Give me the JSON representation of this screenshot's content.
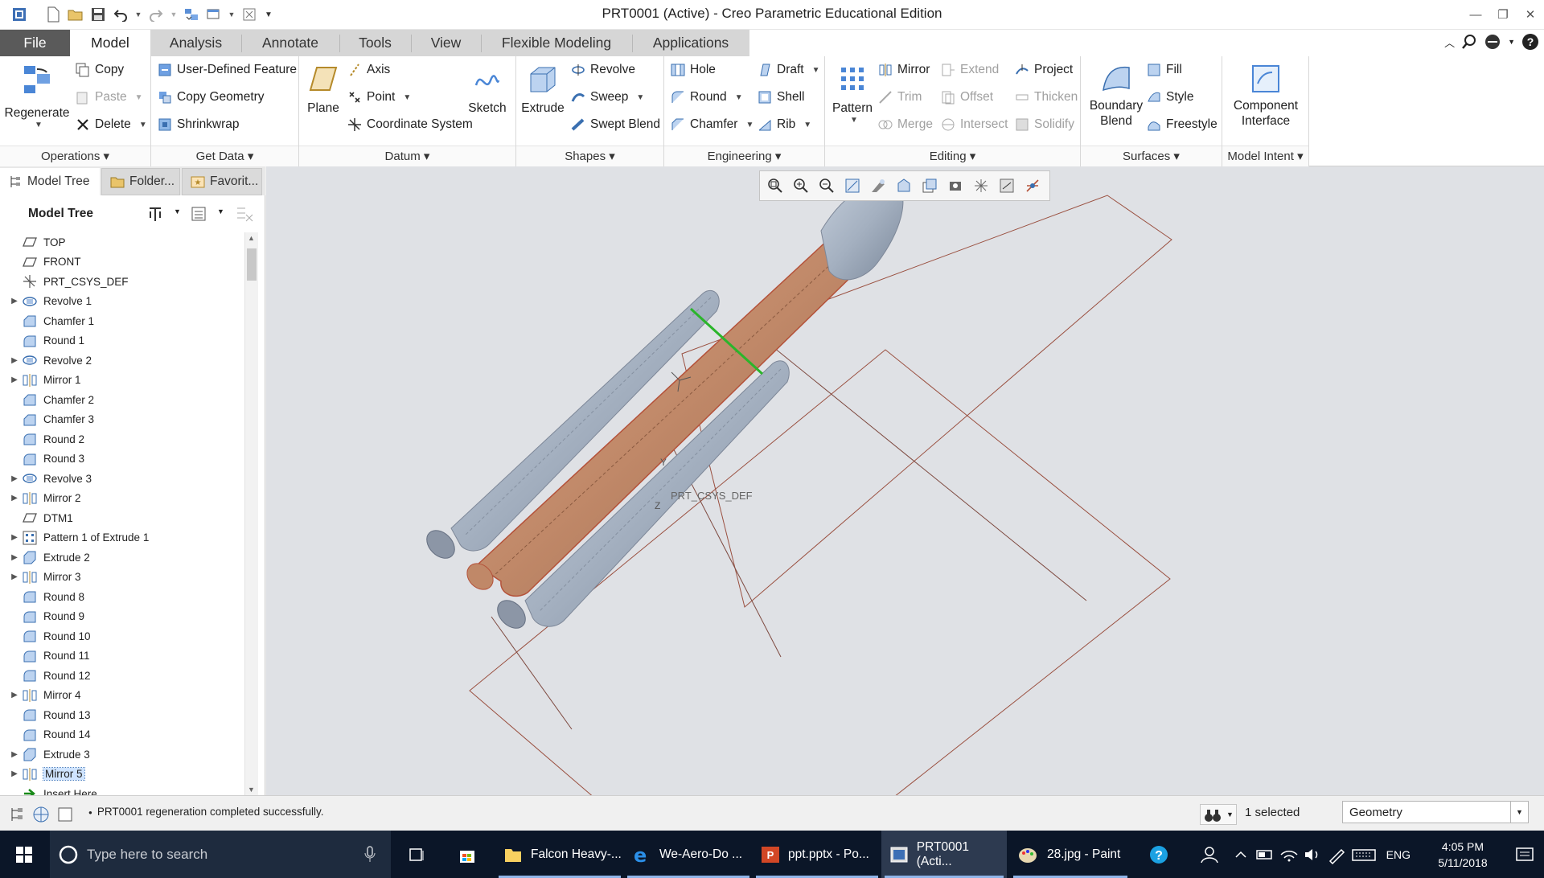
{
  "window": {
    "title": "PRT0001 (Active) - Creo Parametric Educational Edition"
  },
  "tabs": [
    "File",
    "Model",
    "Analysis",
    "Annotate",
    "Tools",
    "View",
    "Flexible Modeling",
    "Applications"
  ],
  "ribbon": {
    "operations": {
      "label": "Operations",
      "regenerate": "Regenerate",
      "copy": "Copy",
      "paste": "Paste",
      "delete": "Delete"
    },
    "get_data": {
      "label": "Get Data",
      "udf": "User-Defined Feature",
      "copy_geometry": "Copy Geometry",
      "shrinkwrap": "Shrinkwrap"
    },
    "datum": {
      "label": "Datum",
      "plane": "Plane",
      "axis": "Axis",
      "point": "Point",
      "csys": "Coordinate System",
      "sketch": "Sketch"
    },
    "shapes": {
      "label": "Shapes",
      "extrude": "Extrude",
      "revolve": "Revolve",
      "sweep": "Sweep",
      "swept_blend": "Swept Blend"
    },
    "engineering": {
      "label": "Engineering",
      "hole": "Hole",
      "round": "Round",
      "chamfer": "Chamfer",
      "draft": "Draft",
      "shell": "Shell",
      "rib": "Rib"
    },
    "editing": {
      "label": "Editing",
      "pattern": "Pattern",
      "mirror": "Mirror",
      "trim": "Trim",
      "merge": "Merge",
      "extend": "Extend",
      "offset": "Offset",
      "intersect": "Intersect",
      "project": "Project",
      "thicken": "Thicken",
      "solidify": "Solidify"
    },
    "surfaces": {
      "label": "Surfaces",
      "boundary_blend": "Boundary Blend",
      "fill": "Fill",
      "style": "Style",
      "freestyle": "Freestyle"
    },
    "model_intent": {
      "label": "Model Intent",
      "component_interface": "Component Interface"
    }
  },
  "navigator": {
    "tabs": [
      "Model Tree",
      "Folder...",
      "Favorit..."
    ],
    "header": "Model Tree"
  },
  "tree": [
    {
      "label": "TOP",
      "icon": "plane-icon",
      "expandable": false
    },
    {
      "label": "FRONT",
      "icon": "plane-icon",
      "expandable": false
    },
    {
      "label": "PRT_CSYS_DEF",
      "icon": "csys-icon",
      "expandable": false
    },
    {
      "label": "Revolve 1",
      "icon": "revolve-icon",
      "expandable": true
    },
    {
      "label": "Chamfer 1",
      "icon": "chamfer-icon",
      "expandable": false
    },
    {
      "label": "Round 1",
      "icon": "round-icon",
      "expandable": false
    },
    {
      "label": "Revolve 2",
      "icon": "revolve-icon",
      "expandable": true
    },
    {
      "label": "Mirror 1",
      "icon": "mirror-icon",
      "expandable": true
    },
    {
      "label": "Chamfer 2",
      "icon": "chamfer-icon",
      "expandable": false
    },
    {
      "label": "Chamfer 3",
      "icon": "chamfer-icon",
      "expandable": false
    },
    {
      "label": "Round 2",
      "icon": "round-icon",
      "expandable": false
    },
    {
      "label": "Round 3",
      "icon": "round-icon",
      "expandable": false
    },
    {
      "label": "Revolve 3",
      "icon": "revolve-icon",
      "expandable": true
    },
    {
      "label": "Mirror 2",
      "icon": "mirror-icon",
      "expandable": true
    },
    {
      "label": "DTM1",
      "icon": "plane-icon",
      "expandable": false
    },
    {
      "label": "Pattern 1 of Extrude 1",
      "icon": "pattern-icon",
      "expandable": true
    },
    {
      "label": "Extrude 2",
      "icon": "extrude-icon",
      "expandable": true
    },
    {
      "label": "Mirror 3",
      "icon": "mirror-icon",
      "expandable": true
    },
    {
      "label": "Round 8",
      "icon": "round-icon",
      "expandable": false
    },
    {
      "label": "Round 9",
      "icon": "round-icon",
      "expandable": false
    },
    {
      "label": "Round 10",
      "icon": "round-icon",
      "expandable": false
    },
    {
      "label": "Round 11",
      "icon": "round-icon",
      "expandable": false
    },
    {
      "label": "Round 12",
      "icon": "round-icon",
      "expandable": false
    },
    {
      "label": "Mirror 4",
      "icon": "mirror-icon",
      "expandable": true
    },
    {
      "label": "Round 13",
      "icon": "round-icon",
      "expandable": false
    },
    {
      "label": "Round 14",
      "icon": "round-icon",
      "expandable": false
    },
    {
      "label": "Extrude 3",
      "icon": "extrude-icon",
      "expandable": true
    },
    {
      "label": "Mirror 5",
      "icon": "mirror-icon",
      "expandable": true,
      "selected": true
    },
    {
      "label": "Insert Here",
      "icon": "insert-arrow-icon",
      "expandable": false
    }
  ],
  "graphics": {
    "csys_label": "PRT_CSYS_DEF",
    "axis_y": "Y",
    "axis_z": "Z",
    "colors": {
      "body": "#a8b4c4",
      "highlight": "#c8906a",
      "edge": "#b4523a",
      "axis_green": "#2bb52b",
      "background": "#dfe1e5"
    }
  },
  "status": {
    "message": "PRT0001 regeneration completed successfully.",
    "selected": "1 selected",
    "filter": "Geometry"
  },
  "taskbar": {
    "search_placeholder": "Type here to search",
    "items": [
      {
        "label": "Falcon Heavy-...",
        "icon": "folder-icon"
      },
      {
        "label": "We-Aero-Do ...",
        "icon": "edge-icon"
      },
      {
        "label": "ppt.pptx - Po...",
        "icon": "powerpoint-icon"
      },
      {
        "label": "PRT0001 (Acti...",
        "icon": "creo-icon",
        "active": true
      },
      {
        "label": "28.jpg - Paint",
        "icon": "paint-icon"
      }
    ],
    "lang": "ENG",
    "time": "4:05 PM",
    "date": "5/11/2018"
  }
}
